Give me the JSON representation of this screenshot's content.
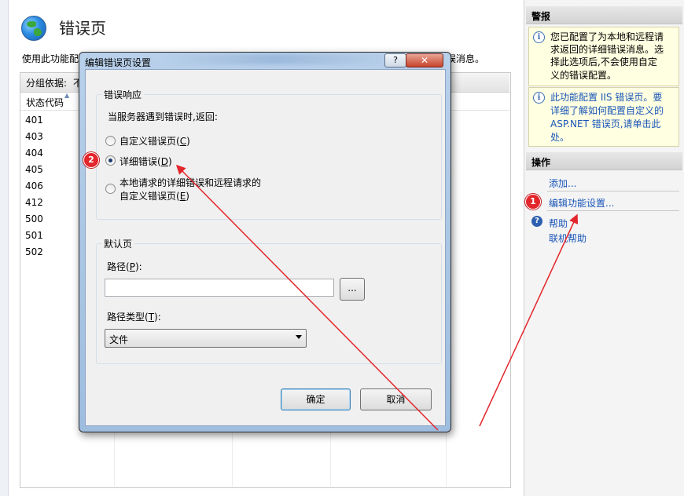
{
  "main": {
    "title": "错误页",
    "desc_start": "使用此功能配",
    "desc_end": "误消息。",
    "group_label": "分组依据:",
    "group_value": "不",
    "column_status": "状态代码",
    "status_codes": [
      "401",
      "403",
      "404",
      "405",
      "406",
      "412",
      "500",
      "501",
      "502"
    ]
  },
  "right": {
    "alerts_title": "警报",
    "alert1": [
      "您已配置了为本地和远程请",
      "求返回的详细错误消息。选",
      "择此选项后,不会使用自定",
      "义的错误配置。"
    ],
    "alert2": [
      "此功能配置 IIS 错误页。要",
      "详细了解如何配置自定义的",
      "ASP.NET 错误页,请单击此",
      "处。"
    ],
    "actions_title": "操作",
    "actions": {
      "add": "添加...",
      "edit": "编辑功能设置...",
      "help": "帮助",
      "online_help": "联机帮助"
    }
  },
  "dialog": {
    "title": "编辑错误页设置",
    "help_btn": "?",
    "close_btn": "✕",
    "group1_legend": "错误响应",
    "group1_prompt": "当服务器遇到错误时,返回:",
    "option_custom": "自定义错误页(",
    "option_custom_key": "C",
    "option_detailed": "详细错误(",
    "option_detailed_key": "D",
    "option_local_line1": "本地请求的详细错误和远程请求的",
    "option_local_line2": "自定义错误页(",
    "option_local_key": "E",
    "group2_legend": "默认页",
    "path_label": "路径(",
    "path_key": "P",
    "path_value": "",
    "browse_btn": "...",
    "path_type_label": "路径类型(",
    "path_type_key": "T",
    "path_type_value": "文件",
    "ok": "确定",
    "cancel": "取消",
    "selected_option": "detailed"
  },
  "annotations": {
    "badge1": "1",
    "badge2": "2",
    "color": "#e3262b"
  }
}
